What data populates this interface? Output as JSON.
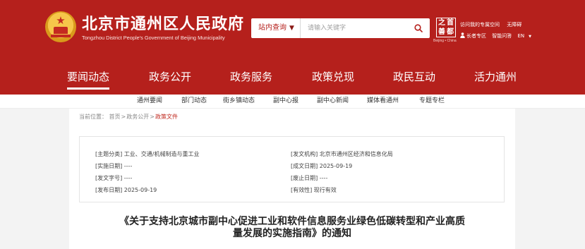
{
  "header": {
    "site_title": "北京市通州区人民政府",
    "site_subtitle": "Tongzhou District People's Government of Beijing Municipality",
    "brand_color": "#b5201c",
    "calligraphy_chars": [
      "之",
      "首",
      "善",
      "都"
    ],
    "calligraphy_sub": "Beijing • China",
    "links_row1": [
      "访问我的专属空间",
      "无障碍"
    ],
    "links_row2": [
      "长者专区",
      "智能问答",
      "EN"
    ]
  },
  "search": {
    "scope_label": "站内查询",
    "placeholder": "请输入关键字",
    "icon": "search-icon"
  },
  "main_nav": {
    "items": [
      "要闻动态",
      "政务公开",
      "政务服务",
      "政策兑现",
      "政民互动",
      "活力通州"
    ],
    "active": "要闻动态"
  },
  "sub_nav": {
    "items": [
      "通州要闻",
      "部门动态",
      "街乡镇动态",
      "副中心报",
      "副中心新闻",
      "媒体看通州",
      "专题专栏"
    ]
  },
  "breadcrumb": {
    "prefix": "当前位置：",
    "items": [
      "首页",
      "政务公开",
      "政策文件"
    ],
    "separator": ">"
  },
  "meta": {
    "topic": "[主题分类] 工业、交通/机械制造与重工业",
    "issuer": "[发文机构] 北京市通州区经济和信息化局",
    "effective_date": "[实施日期] ----",
    "created_date": "[成文日期] 2025-09-19",
    "doc_number": "[发文字号] ----",
    "expire_date": "[废止日期] ----",
    "publish_date": "[发布日期] 2025-09-19",
    "validity": "[有效性] 现行有效"
  },
  "document": {
    "title_line1": "《关于支持北京城市副中心促进工业和软件信息服务业绿色低碳转型和产业高质",
    "title_line2": "量发展的实施指南》的通知"
  }
}
